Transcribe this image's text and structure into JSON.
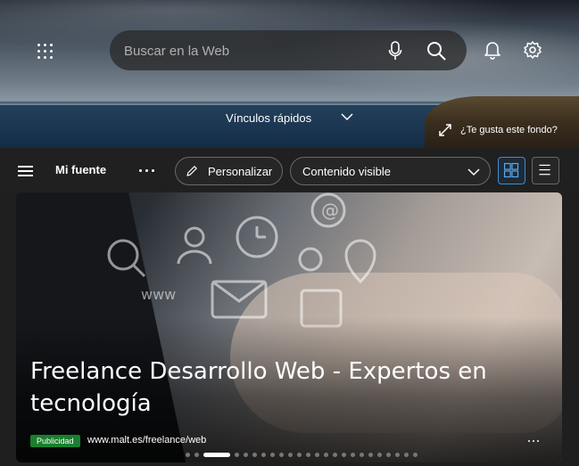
{
  "header": {
    "search": {
      "placeholder": "Buscar en la Web"
    },
    "quick_links_label": "Vínculos rápidos",
    "background_like_label": "¿Te gusta este fondo?"
  },
  "toolbar": {
    "feed_title": "Mi fuente",
    "personalize_label": "Personalizar",
    "content_select_value": "Contenido visible"
  },
  "card": {
    "title": "Freelance Desarrollo Web - Expertos en tecnología",
    "ad_badge": "Publicidad",
    "ad_url": "www.malt.es/freelance/web"
  },
  "carousel": {
    "total_dots": 24,
    "active_index": 2
  },
  "colors": {
    "accent_blue": "#3a8fd8",
    "ad_green": "#1a7f2e",
    "toolbar_bg": "#202020"
  },
  "icons": [
    "apps-icon",
    "mic-icon",
    "search-icon",
    "bell-icon",
    "gear-icon",
    "chevron-down-icon",
    "expand-icon",
    "menu-icon",
    "more-icon",
    "pencil-icon",
    "grid-view-icon",
    "list-view-icon"
  ]
}
